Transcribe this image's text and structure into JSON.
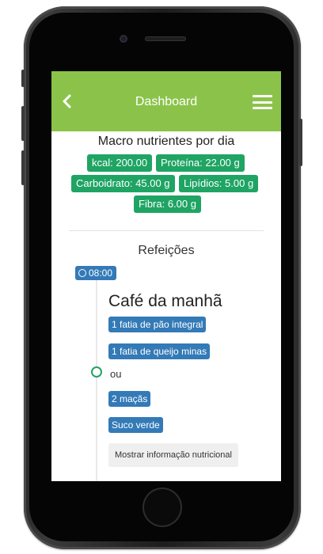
{
  "header": {
    "title": "Dashboard",
    "back_icon": "chevron-left-icon",
    "menu_icon": "hamburger-menu-icon"
  },
  "macros": {
    "title": "Macro nutrientes por dia",
    "items": [
      {
        "label": "kcal: 200.00"
      },
      {
        "label": "Proteína: 22.00 g"
      },
      {
        "label": "Carboidrato: 45.00 g"
      },
      {
        "label": "Lipídios: 5.00 g"
      },
      {
        "label": "Fibra: 6.00 g"
      }
    ],
    "color": "#1fa464"
  },
  "meals": {
    "title": "Refeições",
    "entries": [
      {
        "time": "08:00",
        "name": "Café da manhã",
        "option_1": [
          "1 fatia de pão integral",
          "1 fatia de queijo minas"
        ],
        "separator": "ou",
        "option_2": [
          "2 maçãs",
          "Suco verde"
        ],
        "info_button": "Mostrar informação nutricional"
      }
    ]
  },
  "colors": {
    "appbar": "#8bc34a",
    "food_badge": "#337ab7",
    "macro_badge": "#1fa464"
  }
}
